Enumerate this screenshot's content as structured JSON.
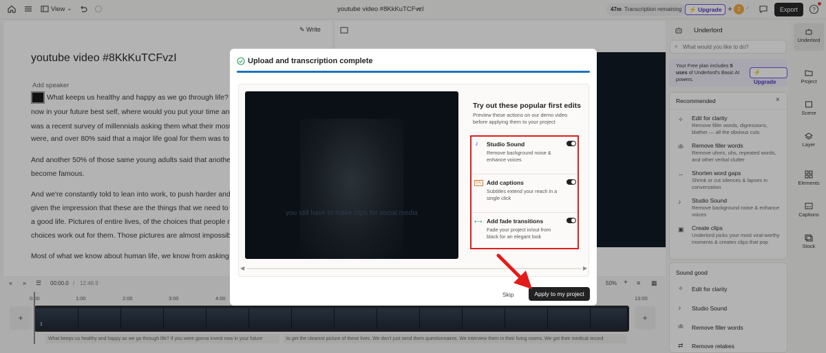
{
  "topbar": {
    "view_label": "View",
    "doc_title": "youtube video #8KkKuTCFvzI",
    "transcription_minutes": "47m",
    "transcription_label": "Transcription remaining",
    "upgrade_label": "Upgrade",
    "export_label": "Export",
    "badge_count": "2"
  },
  "editor": {
    "write_label": "Write",
    "title": "youtube video #8KkKuTCFvzI",
    "add_speaker": "Add speaker",
    "lines": [
      "What keeps us healthy and happy as we go through life? If",
      "now in your future best self, where would you put your time and",
      "was a recent survey of millennials asking them what their most",
      "were, and over 80% said that a major life goal for them was to g",
      "And another 50% of those same young adults said that another",
      "become famous.",
      "And we're constantly told to lean into work, to push harder and",
      "given the impression that these are the things that we need to g",
      "a good life. Pictures of entire lives, of the choices that people m",
      "choices work out for them. Those pictures are almost impossibl",
      "Most of what we know about human life, we know from asking"
    ]
  },
  "modal": {
    "header": "Upload and transcription complete",
    "subtitle": "you still have to make clips for social media",
    "try_title": "Try out these popular first edits",
    "try_desc": "Preview these actions on our demo video before applying them to your project",
    "features": [
      {
        "title": "Studio Sound",
        "desc": "Remove background noise & enhance voices",
        "icon": "mic-wave-icon",
        "enabled": true
      },
      {
        "title": "Add captions",
        "desc": "Subtitles extend your reach in a single click",
        "icon": "cc-icon",
        "enabled": true
      },
      {
        "title": "Add fade transitions",
        "desc": "Fade your project in/out from black for an elegant look",
        "icon": "fade-icon",
        "enabled": true
      }
    ],
    "skip_label": "Skip",
    "apply_label": "Apply to my project"
  },
  "panel": {
    "title": "Underlord",
    "search_placeholder": "What would you like to do?",
    "plan_text_1": "Your Free plan includes ",
    "plan_count": "5",
    "plan_text_2": "uses",
    "plan_text_3": " of Underlord's Basic AI powers.",
    "upgrade_label": "Upgrade",
    "recommended_title": "Recommended",
    "recommended": [
      {
        "title": "Edit for clarity",
        "desc": "Remove filler words, digressions, blather — all the obvious cuts"
      },
      {
        "title": "Remove filler words",
        "desc": "Remove uhms, uhs, repeated words, and other verbal clutter"
      },
      {
        "title": "Shorten word gaps",
        "desc": "Shrink or cut silences & lapses in conversation"
      },
      {
        "title": "Studio Sound",
        "desc": "Remove background noise & enhance voices"
      },
      {
        "title": "Create clips",
        "desc": "Underlord picks your most viral-worthy moments & creates clips that pop"
      }
    ],
    "sound_good_title": "Sound good",
    "sound_good": [
      "Edit for clarity",
      "Studio Sound",
      "Remove filler words",
      "Remove retakes"
    ]
  },
  "sidebar": {
    "items": [
      "Underlord",
      "Project",
      "Scene",
      "Layer",
      "Elements",
      "Captions",
      "Stock"
    ]
  },
  "timeline": {
    "current_time": "00:00.0",
    "separator": "/",
    "total_time": "12:46.9",
    "zoom": "50%",
    "ticks": [
      "0:00",
      "1:00",
      "2:00",
      "3:00",
      "4:00",
      "13:00"
    ],
    "scene_number": "1",
    "transcript_1": "What keeps us healthy and happy as we go through life? If you were gonna invest now in your future",
    "transcript_2": "to get the clearest picture of these lives. We don't just send them questionnaires. We interview them in their living rooms. We get their medical record"
  },
  "colors": {
    "accent_purple": "#6a4ddc",
    "highlight_red": "#e21b1b",
    "progress_blue": "#1a73b8"
  }
}
